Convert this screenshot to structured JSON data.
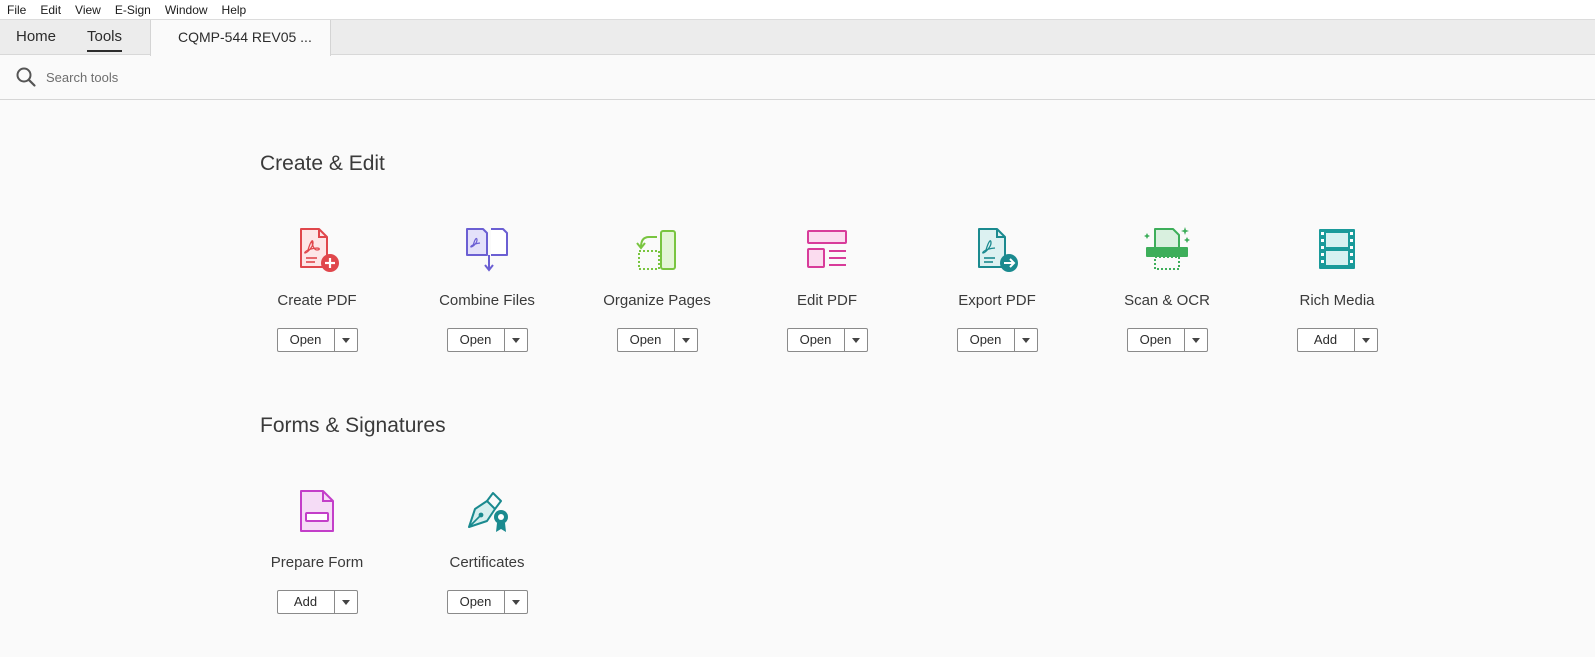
{
  "menubar": {
    "items": [
      "File",
      "Edit",
      "View",
      "E-Sign",
      "Window",
      "Help"
    ]
  },
  "tabs": {
    "home": "Home",
    "tools": "Tools",
    "document": "CQMP-544 REV05 ..."
  },
  "search": {
    "placeholder": "Search tools"
  },
  "sections": [
    {
      "title": "Create & Edit",
      "tools": [
        {
          "label": "Create PDF",
          "button": "Open",
          "icon": "create-pdf-icon",
          "color": "#e0474c"
        },
        {
          "label": "Combine Files",
          "button": "Open",
          "icon": "combine-files-icon",
          "color": "#6b5fd3"
        },
        {
          "label": "Organize Pages",
          "button": "Open",
          "icon": "organize-pages-icon",
          "color": "#79c540"
        },
        {
          "label": "Edit PDF",
          "button": "Open",
          "icon": "edit-pdf-icon",
          "color": "#d83c9a"
        },
        {
          "label": "Export PDF",
          "button": "Open",
          "icon": "export-pdf-icon",
          "color": "#1a8a8f"
        },
        {
          "label": "Scan & OCR",
          "button": "Open",
          "icon": "scan-ocr-icon",
          "color": "#3dae5a"
        },
        {
          "label": "Rich Media",
          "button": "Add",
          "icon": "rich-media-icon",
          "color": "#1a9a9a"
        }
      ]
    },
    {
      "title": "Forms & Signatures",
      "tools": [
        {
          "label": "Prepare Form",
          "button": "Add",
          "icon": "prepare-form-icon",
          "color": "#c33ec9"
        },
        {
          "label": "Certificates",
          "button": "Open",
          "icon": "certificates-icon",
          "color": "#1a8a8f"
        }
      ]
    }
  ]
}
